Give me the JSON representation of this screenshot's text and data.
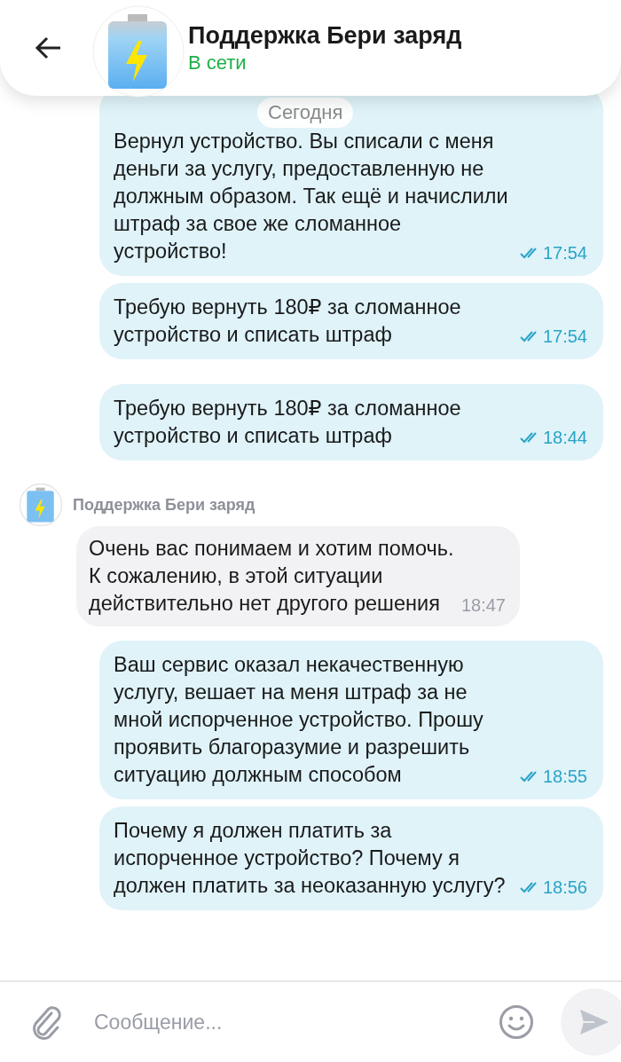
{
  "header": {
    "title": "Поддержка Бери заряд",
    "status": "В сети"
  },
  "date_pill": "Сегодня",
  "messages": [
    {
      "kind": "outgoing",
      "text": "Вернул устройство. Вы списали с меня деньги за услугу, предоставленную не должным образом. Так ещё и начислили штраф за свое же сломанное устройство!",
      "time": "17:54",
      "read": true
    },
    {
      "kind": "outgoing",
      "text": "Требую вернуть 180₽ за сломанное устройство и списать штраф",
      "time": "17:54",
      "read": true
    },
    {
      "kind": "outgoing",
      "text": "Требую вернуть 180₽ за сломанное устройство и списать штраф",
      "time": "18:44",
      "read": true
    },
    {
      "kind": "incoming",
      "sender": "Поддержка Бери заряд",
      "text": "Очень вас понимаем и хотим помочь. К сожалению, в этой ситуации действительно нет другого решения",
      "time": "18:47"
    },
    {
      "kind": "outgoing",
      "text": "Ваш сервис оказал некачественную услугу, вешает на меня штраф за не мной испорченное устройство. Прошу проявить благоразумие и разрешить ситуацию должным способом",
      "time": "18:55",
      "read": true
    },
    {
      "kind": "outgoing",
      "text": "Почему я должен платить за испорченное устройство? Почему я должен платить за неоказанную услугу?",
      "time": "18:56",
      "read": true
    }
  ],
  "composer": {
    "placeholder": "Сообщение..."
  }
}
